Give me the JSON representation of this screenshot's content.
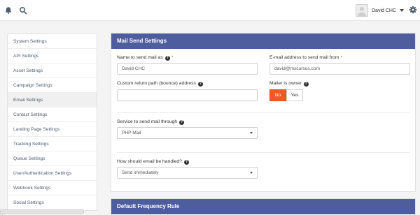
{
  "topbar": {
    "user_name": "David CHC"
  },
  "sidebar": {
    "items": [
      {
        "label": "System Settings"
      },
      {
        "label": "API Settings"
      },
      {
        "label": "Asset Settings"
      },
      {
        "label": "Campaign Settings"
      },
      {
        "label": "Email Settings"
      },
      {
        "label": "Contact Settings"
      },
      {
        "label": "Landing Page Settings"
      },
      {
        "label": "Tracking Settings"
      },
      {
        "label": "Queue Settings"
      },
      {
        "label": "User/Authentication Settings"
      },
      {
        "label": "Webhook Settings"
      },
      {
        "label": "Social Settings"
      }
    ],
    "active_index": 4,
    "scroll_fragment": "..."
  },
  "mail_send": {
    "title": "Mail Send Settings",
    "name_label": "Name to send mail as",
    "name_value": "David CHC",
    "email_label": "E-mail address to send mail from",
    "email_value": "david@mxcursos.com",
    "return_path_label": "Custom return path (bounce) address",
    "return_path_value": "",
    "mailer_owner_label": "Mailer is owner",
    "mailer_owner_no": "No",
    "mailer_owner_yes": "Yes",
    "service_label": "Service to send mail through",
    "service_value": "PHP Mail",
    "handling_label": "How should email be handled?",
    "handling_value": "Send immediately",
    "required_mark": "*",
    "help_glyph": "?"
  },
  "frequency": {
    "title": "Default Frequency Rule"
  },
  "colors": {
    "panel_header": "#4e5d9d",
    "accent": "#f1592a",
    "required": "#e74c3c"
  },
  "icons": [
    "bell-icon",
    "search-icon",
    "chevron-down-icon",
    "gear-icon",
    "question-circle-icon"
  ]
}
